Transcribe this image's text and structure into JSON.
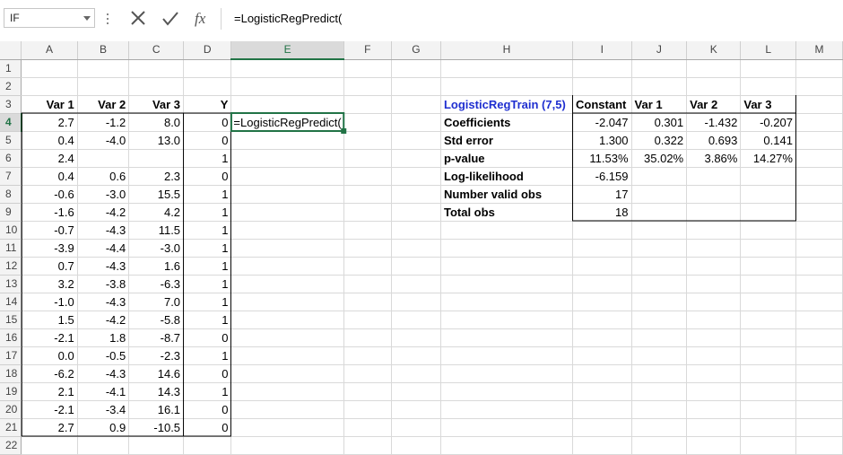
{
  "namebox": {
    "value": "IF"
  },
  "formula_bar": {
    "content": "=LogisticRegPredict("
  },
  "icons": {
    "cancel": "cancel-x-icon",
    "enter": "check-icon",
    "function": "fx-icon"
  },
  "colors": {
    "accent": "#217346",
    "title_blue": "#1f2fd0"
  },
  "columns": [
    "A",
    "B",
    "C",
    "D",
    "E",
    "F",
    "G",
    "H",
    "I",
    "J",
    "K",
    "L",
    "M"
  ],
  "rows": [
    "1",
    "2",
    "3",
    "4",
    "5",
    "6",
    "7",
    "8",
    "9",
    "10",
    "11",
    "12",
    "13",
    "14",
    "15",
    "16",
    "17",
    "18",
    "19",
    "20",
    "21",
    "22"
  ],
  "cells": [
    [
      "",
      "",
      "",
      "",
      "",
      "",
      "",
      "",
      "",
      "",
      "",
      "",
      ""
    ],
    [
      "",
      "",
      "",
      "",
      "",
      "",
      "",
      "",
      "",
      "",
      "",
      "",
      ""
    ],
    [
      "Var 1",
      "Var 2",
      "Var 3",
      "Y",
      "",
      "",
      "",
      "LogisticRegTrain (7,5)",
      "Constant",
      "Var 1",
      "Var 2",
      "Var 3",
      ""
    ],
    [
      "2.7",
      "-1.2",
      "8.0",
      "0",
      "=LogisticRegPredict(",
      "",
      "",
      "Coefficients",
      "-2.047",
      "0.301",
      "-1.432",
      "-0.207",
      ""
    ],
    [
      "0.4",
      "-4.0",
      "13.0",
      "0",
      "",
      "",
      "",
      "Std error",
      "1.300",
      "0.322",
      "0.693",
      "0.141",
      ""
    ],
    [
      "2.4",
      "",
      "",
      "1",
      "",
      "",
      "",
      "p-value",
      "11.53%",
      "35.02%",
      "3.86%",
      "14.27%",
      ""
    ],
    [
      "0.4",
      "0.6",
      "2.3",
      "0",
      "",
      "",
      "",
      "Log-likelihood",
      "-6.159",
      "",
      "",
      "",
      ""
    ],
    [
      "-0.6",
      "-3.0",
      "15.5",
      "1",
      "",
      "",
      "",
      "Number valid obs",
      "17",
      "",
      "",
      "",
      ""
    ],
    [
      "-1.6",
      "-4.2",
      "4.2",
      "1",
      "",
      "",
      "",
      "Total obs",
      "18",
      "",
      "",
      "",
      ""
    ],
    [
      "-0.7",
      "-4.3",
      "11.5",
      "1",
      "",
      "",
      "",
      "",
      "",
      "",
      "",
      "",
      ""
    ],
    [
      "-3.9",
      "-4.4",
      "-3.0",
      "1",
      "",
      "",
      "",
      "",
      "",
      "",
      "",
      "",
      ""
    ],
    [
      "0.7",
      "-4.3",
      "1.6",
      "1",
      "",
      "",
      "",
      "",
      "",
      "",
      "",
      "",
      ""
    ],
    [
      "3.2",
      "-3.8",
      "-6.3",
      "1",
      "",
      "",
      "",
      "",
      "",
      "",
      "",
      "",
      ""
    ],
    [
      "-1.0",
      "-4.3",
      "7.0",
      "1",
      "",
      "",
      "",
      "",
      "",
      "",
      "",
      "",
      ""
    ],
    [
      "1.5",
      "-4.2",
      "-5.8",
      "1",
      "",
      "",
      "",
      "",
      "",
      "",
      "",
      "",
      ""
    ],
    [
      "-2.1",
      "1.8",
      "-8.7",
      "0",
      "",
      "",
      "",
      "",
      "",
      "",
      "",
      "",
      ""
    ],
    [
      "0.0",
      "-0.5",
      "-2.3",
      "1",
      "",
      "",
      "",
      "",
      "",
      "",
      "",
      "",
      ""
    ],
    [
      "-6.2",
      "-4.3",
      "14.6",
      "0",
      "",
      "",
      "",
      "",
      "",
      "",
      "",
      "",
      ""
    ],
    [
      "2.1",
      "-4.1",
      "14.3",
      "1",
      "",
      "",
      "",
      "",
      "",
      "",
      "",
      "",
      ""
    ],
    [
      "-2.1",
      "-3.4",
      "16.1",
      "0",
      "",
      "",
      "",
      "",
      "",
      "",
      "",
      "",
      ""
    ],
    [
      "2.7",
      "0.9",
      "-10.5",
      "0",
      "",
      "",
      "",
      "",
      "",
      "",
      "",
      "",
      ""
    ],
    [
      "",
      "",
      "",
      "",
      "",
      "",
      "",
      "",
      "",
      "",
      "",
      "",
      ""
    ]
  ],
  "selected": {
    "col": "E",
    "row": "4"
  }
}
